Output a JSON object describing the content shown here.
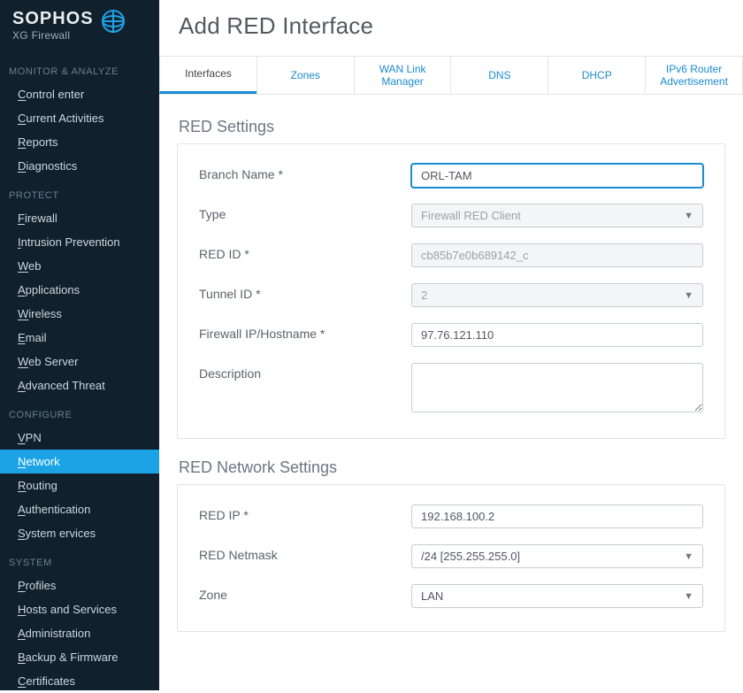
{
  "brand": {
    "title": "SOPHOS",
    "subtitle": "XG Firewall"
  },
  "nav": {
    "groups": [
      {
        "title": "MONITOR & ANALYZE",
        "items": [
          {
            "label": "Control Center",
            "u": "C"
          },
          {
            "label": "Current Activities",
            "u": "C"
          },
          {
            "label": "Reports",
            "u": "R"
          },
          {
            "label": "Diagnostics",
            "u": "D"
          }
        ]
      },
      {
        "title": "PROTECT",
        "items": [
          {
            "label": "Firewall",
            "u": "F"
          },
          {
            "label": "Intrusion Prevention",
            "u": "I"
          },
          {
            "label": "Web",
            "u": "W"
          },
          {
            "label": "Applications",
            "u": "A"
          },
          {
            "label": "Wireless",
            "u": "W"
          },
          {
            "label": "Email",
            "u": "E"
          },
          {
            "label": "Web Server",
            "u": "W"
          },
          {
            "label": "Advanced Threat",
            "u": "A"
          }
        ]
      },
      {
        "title": "CONFIGURE",
        "items": [
          {
            "label": "VPN",
            "u": "V"
          },
          {
            "label": "Network",
            "u": "N",
            "active": true
          },
          {
            "label": "Routing",
            "u": "R"
          },
          {
            "label": "Authentication",
            "u": "A"
          },
          {
            "label": "System Services",
            "u": "S"
          }
        ]
      },
      {
        "title": "SYSTEM",
        "items": [
          {
            "label": "Profiles",
            "u": "P"
          },
          {
            "label": "Hosts and Services",
            "u": "H"
          },
          {
            "label": "Administration",
            "u": "A"
          },
          {
            "label": "Backup & Firmware",
            "u": "B"
          },
          {
            "label": "Certificates",
            "u": "C"
          }
        ]
      }
    ]
  },
  "page": {
    "title": "Add RED Interface"
  },
  "tabs": [
    {
      "label": "Interfaces",
      "active": true
    },
    {
      "label": "Zones"
    },
    {
      "label": "WAN Link Manager"
    },
    {
      "label": "DNS"
    },
    {
      "label": "DHCP"
    },
    {
      "label": "IPv6 Router Advertisement"
    }
  ],
  "sections": {
    "red_settings": {
      "title": "RED Settings",
      "fields": {
        "branch_name": {
          "label": "Branch Name *",
          "value": "ORL-TAM"
        },
        "type": {
          "label": "Type",
          "value": "Firewall RED Client",
          "disabled": true
        },
        "red_id": {
          "label": "RED ID *",
          "value": "cb85b7e0b689142_c",
          "disabled": true
        },
        "tunnel_id": {
          "label": "Tunnel ID *",
          "value": "2",
          "disabled": true
        },
        "firewall_ip": {
          "label": "Firewall IP/Hostname *",
          "value": "97.76.121.110"
        },
        "description": {
          "label": "Description",
          "value": ""
        }
      }
    },
    "red_network": {
      "title": "RED Network Settings",
      "fields": {
        "red_ip": {
          "label": "RED IP *",
          "value": "192.168.100.2"
        },
        "red_netmask": {
          "label": "RED Netmask",
          "value": "/24 [255.255.255.0]"
        },
        "zone": {
          "label": "Zone",
          "value": "LAN"
        }
      }
    }
  }
}
